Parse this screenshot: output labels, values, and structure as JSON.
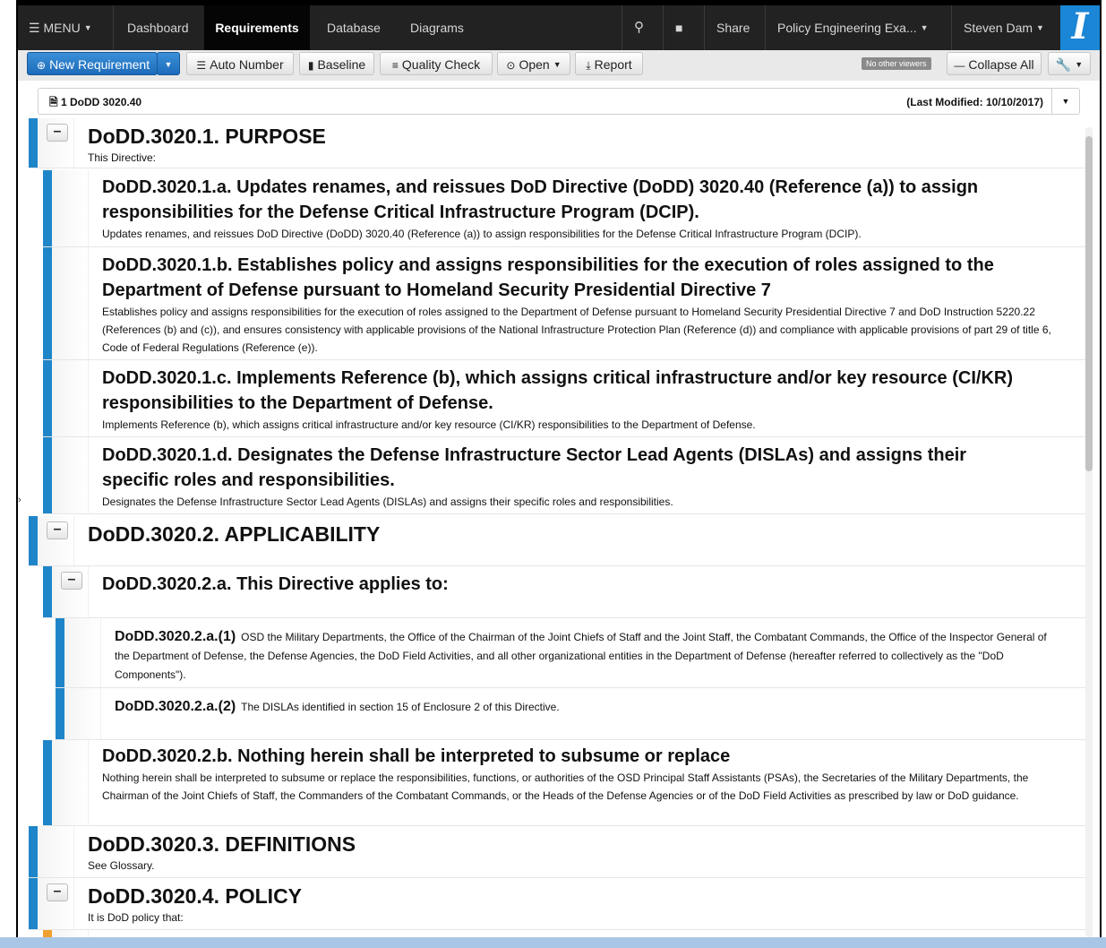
{
  "nav": {
    "menu_label": "MENU",
    "tabs": [
      {
        "label": "Dashboard"
      },
      {
        "label": "Requirements"
      },
      {
        "label": "Database"
      },
      {
        "label": "Diagrams"
      }
    ],
    "share_label": "Share",
    "project_label": "Policy Engineering Exa...",
    "user_label": "Steven Dam",
    "logo_glyph": "I"
  },
  "toolbar": {
    "new_requirement": "New Requirement",
    "auto_number": "Auto Number",
    "baseline": "Baseline",
    "quality_check": "Quality Check",
    "open": "Open",
    "report": "Report",
    "viewers_badge": "No other viewers",
    "collapse_all": "Collapse All"
  },
  "document": {
    "title": "1 DoDD 3020.40",
    "last_modified": "(Last Modified: 10/10/2017)"
  },
  "requirements": [
    {
      "title": "DoDD.3020.1. PURPOSE",
      "desc": "This Directive:"
    },
    {
      "title_l1": "DoDD.3020.1.a. Updates renames, and reissues DoD Directive (DoDD) 3020.40 (Reference (a)) to assign",
      "title_l2": "responsibilities for the Defense Critical Infrastructure Program (DCIP).",
      "desc": "Updates renames, and reissues DoD Directive (DoDD) 3020.40 (Reference (a)) to assign responsibilities for the Defense Critical Infrastructure Program (DCIP)."
    },
    {
      "title_l1": "DoDD.3020.1.b. Establishes policy and assigns responsibilities for the execution of roles assigned to the",
      "title_l2": "Department of Defense pursuant to Homeland Security Presidential Directive 7",
      "desc": "Establishes policy and assigns responsibilities for the execution of roles assigned to the Department of Defense pursuant to Homeland Security Presidential Directive 7 and DoD Instruction 5220.22 (References (b) and (c)), and ensures consistency with applicable provisions of the National Infrastructure Protection Plan (Reference (d)) and compliance with applicable provisions of part 29 of title 6, Code of Federal Regulations (Reference (e))."
    },
    {
      "title_l1": "DoDD.3020.1.c. Implements Reference (b), which assigns critical infrastructure and/or key resource (CI/KR)",
      "title_l2": "responsibilities to the Department of Defense.",
      "desc": "Implements Reference (b), which assigns critical infrastructure and/or key resource (CI/KR) responsibilities to the Department of Defense."
    },
    {
      "title_l1": "DoDD.3020.1.d. Designates the Defense Infrastructure Sector Lead Agents (DISLAs) and assigns their",
      "title_l2": "specific roles and responsibilities.",
      "desc": "Designates the Defense Infrastructure Sector Lead Agents (DISLAs) and assigns their specific roles and responsibilities."
    },
    {
      "title": "DoDD.3020.2. APPLICABILITY"
    },
    {
      "title": "DoDD.3020.2.a. This Directive applies to:"
    },
    {
      "label": "DoDD.3020.2.a.(1)",
      "desc": "OSD the Military Departments, the Office of the Chairman of the Joint Chiefs of Staff and the Joint Staff, the Combatant Commands, the Office of the Inspector General of the Department of Defense, the Defense Agencies, the DoD Field Activities, and all other organizational entities in the Department of Defense (hereafter referred to collectively as the \"DoD Components\")."
    },
    {
      "label": "DoDD.3020.2.a.(2)",
      "desc": "The DISLAs identified in section 15 of Enclosure 2 of this Directive."
    },
    {
      "title": "DoDD.3020.2.b. Nothing herein shall be interpreted to subsume or replace",
      "desc": "Nothing herein shall be interpreted to subsume or replace the responsibilities, functions, or authorities of the OSD Principal Staff Assistants (PSAs), the Secretaries of the Military Departments, the Chairman of the Joint Chiefs of Staff, the Commanders of the Combatant Commands, or the Heads of the Defense Agencies or of the DoD Field Activities as prescribed by law or DoD guidance."
    },
    {
      "title": "DoDD.3020.3. DEFINITIONS",
      "desc": "See Glossary."
    },
    {
      "title": "DoDD.3020.4. POLICY",
      "desc": "It is DoD policy that:"
    }
  ],
  "colors": {
    "accent": "#1f85c9",
    "nav_bg": "#222222",
    "logo_bg": "#1b86d6"
  }
}
